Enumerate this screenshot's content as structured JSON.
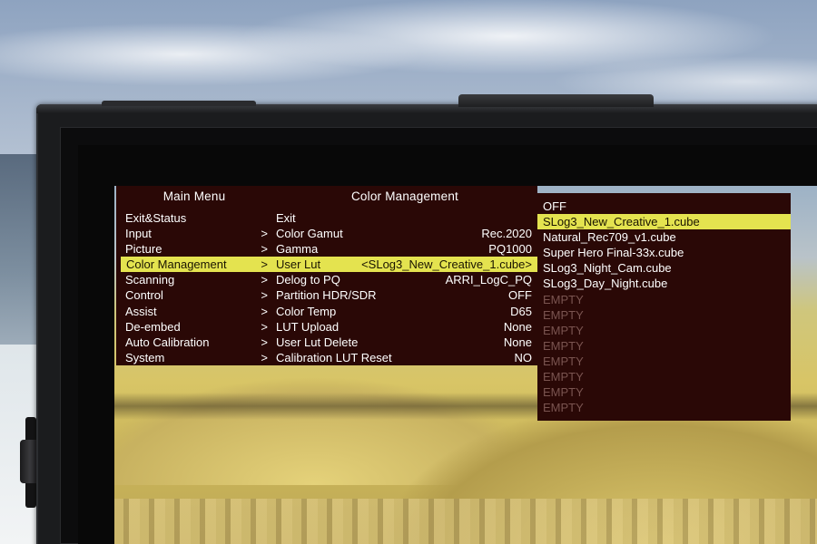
{
  "main_menu": {
    "title": "Main Menu",
    "items": [
      {
        "label": "Exit&Status",
        "arrow": ""
      },
      {
        "label": "Input",
        "arrow": ">"
      },
      {
        "label": "Picture",
        "arrow": ">"
      },
      {
        "label": "Color Management",
        "arrow": ">",
        "selected": true
      },
      {
        "label": "Scanning",
        "arrow": ">"
      },
      {
        "label": "Control",
        "arrow": ">"
      },
      {
        "label": "Assist",
        "arrow": ">"
      },
      {
        "label": "De-embed",
        "arrow": ">"
      },
      {
        "label": "Auto Calibration",
        "arrow": ">"
      },
      {
        "label": "System",
        "arrow": ">"
      }
    ]
  },
  "color_management": {
    "title": "Color Management",
    "items": [
      {
        "label": "Exit",
        "value": ""
      },
      {
        "label": "Color Gamut",
        "value": "Rec.2020"
      },
      {
        "label": "Gamma",
        "value": "PQ1000"
      },
      {
        "label": "User Lut",
        "value": "<SLog3_New_Creative_1.cube>",
        "selected": true
      },
      {
        "label": "Delog to PQ",
        "value": "ARRI_LogC_PQ"
      },
      {
        "label": "Partition HDR/SDR",
        "value": "OFF"
      },
      {
        "label": "Color Temp",
        "value": "D65"
      },
      {
        "label": "LUT Upload",
        "value": "None"
      },
      {
        "label": "User Lut Delete",
        "value": "None"
      },
      {
        "label": "Calibration LUT Reset",
        "value": "NO"
      }
    ]
  },
  "lut_options": {
    "items": [
      {
        "label": "OFF",
        "state": "normal"
      },
      {
        "label": "SLog3_New_Creative_1.cube",
        "state": "selected"
      },
      {
        "label": "Natural_Rec709_v1.cube",
        "state": "normal"
      },
      {
        "label": "Super Hero Final-33x.cube",
        "state": "normal"
      },
      {
        "label": "SLog3_Night_Cam.cube",
        "state": "normal"
      },
      {
        "label": "SLog3_Day_Night.cube",
        "state": "normal"
      },
      {
        "label": "EMPTY",
        "state": "empty"
      },
      {
        "label": "EMPTY",
        "state": "empty"
      },
      {
        "label": "EMPTY",
        "state": "empty"
      },
      {
        "label": "EMPTY",
        "state": "empty"
      },
      {
        "label": "EMPTY",
        "state": "empty"
      },
      {
        "label": "EMPTY",
        "state": "empty"
      },
      {
        "label": "EMPTY",
        "state": "empty"
      },
      {
        "label": "EMPTY",
        "state": "empty"
      }
    ]
  },
  "colors": {
    "osd_background": "#2a0806",
    "highlight": "#e4e34f",
    "text": "#ffffff",
    "empty_text": "#7a5450",
    "bezel": "#1b1c1e"
  }
}
